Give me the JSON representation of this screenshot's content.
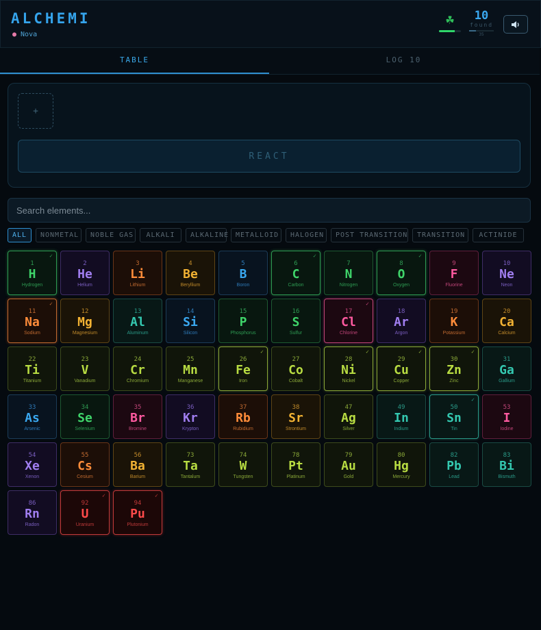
{
  "header": {
    "title": "ALCHEMI",
    "player_name": "Nova",
    "player_icon": "brain-icon",
    "luck_icon": "shamrock-icon",
    "luck_fraction": 0.72,
    "found_count": "10",
    "found_label": "found",
    "found_total": "35",
    "sound_icon": "speaker-icon"
  },
  "tabs": [
    {
      "label": "TABLE",
      "active": true
    },
    {
      "label": "LOG 10",
      "active": false
    }
  ],
  "reactor": {
    "slot_label": "+",
    "react_label": "REACT"
  },
  "search": {
    "placeholder": "Search elements..."
  },
  "filters": [
    "ALL",
    "NONMETAL",
    "NOBLE GAS",
    "ALKALI",
    "ALKALINE",
    "METALLOID",
    "HALOGEN",
    "POST TRANSITION",
    "TRANSITION",
    "ACTINIDE"
  ],
  "active_filter": "ALL",
  "categories": {
    "nonmetal": {
      "text": "#3fd46a",
      "border": "#1e5a32",
      "bg": "#08170f",
      "sub": "#2e9a52"
    },
    "noble": {
      "text": "#a07ef0",
      "border": "#3f2d66",
      "bg": "#120c22",
      "sub": "#7a5ec0"
    },
    "alkali": {
      "text": "#ff8c3a",
      "border": "#6a3518",
      "bg": "#1c0e07",
      "sub": "#c06a30"
    },
    "alkaline": {
      "text": "#f2b233",
      "border": "#5f4515",
      "bg": "#1a1307",
      "sub": "#c08a2a"
    },
    "metalloid": {
      "text": "#3aa8f0",
      "border": "#1c3c58",
      "bg": "#08131f",
      "sub": "#2e7ab8"
    },
    "halogen": {
      "text": "#ff5aa0",
      "border": "#5f1f3c",
      "bg": "#1c0811",
      "sub": "#c04578"
    },
    "transition": {
      "text": "#b8dc42",
      "border": "#3d4b1c",
      "bg": "#10150a",
      "sub": "#8aa838"
    },
    "post": {
      "text": "#34c8b0",
      "border": "#1a4b44",
      "bg": "#081816",
      "sub": "#2a9a88"
    },
    "actinide": {
      "text": "#ff4a4a",
      "border": "#6a1c1c",
      "bg": "#1c0707",
      "sub": "#c03a3a"
    }
  },
  "elements": [
    {
      "n": "1",
      "sym": "H",
      "name": "Hydrogen",
      "cat": "nonmetal",
      "found": true
    },
    {
      "n": "2",
      "sym": "He",
      "name": "Helium",
      "cat": "noble",
      "found": false
    },
    {
      "n": "3",
      "sym": "Li",
      "name": "Lithium",
      "cat": "alkali",
      "found": false
    },
    {
      "n": "4",
      "sym": "Be",
      "name": "Beryllium",
      "cat": "alkaline",
      "found": false
    },
    {
      "n": "5",
      "sym": "B",
      "name": "Boron",
      "cat": "metalloid",
      "found": false
    },
    {
      "n": "6",
      "sym": "C",
      "name": "Carbon",
      "cat": "nonmetal",
      "found": true
    },
    {
      "n": "7",
      "sym": "N",
      "name": "Nitrogen",
      "cat": "nonmetal",
      "found": false
    },
    {
      "n": "8",
      "sym": "O",
      "name": "Oxygen",
      "cat": "nonmetal",
      "found": true
    },
    {
      "n": "9",
      "sym": "F",
      "name": "Fluorine",
      "cat": "halogen",
      "found": false
    },
    {
      "n": "10",
      "sym": "Ne",
      "name": "Neon",
      "cat": "noble",
      "found": false
    },
    {
      "n": "11",
      "sym": "Na",
      "name": "Sodium",
      "cat": "alkali",
      "found": true
    },
    {
      "n": "12",
      "sym": "Mg",
      "name": "Magnesium",
      "cat": "alkaline",
      "found": false
    },
    {
      "n": "13",
      "sym": "Al",
      "name": "Aluminum",
      "cat": "post",
      "found": false
    },
    {
      "n": "14",
      "sym": "Si",
      "name": "Silicon",
      "cat": "metalloid",
      "found": false
    },
    {
      "n": "15",
      "sym": "P",
      "name": "Phosphorus",
      "cat": "nonmetal",
      "found": false
    },
    {
      "n": "16",
      "sym": "S",
      "name": "Sulfur",
      "cat": "nonmetal",
      "found": false
    },
    {
      "n": "17",
      "sym": "Cl",
      "name": "Chlorine",
      "cat": "halogen",
      "found": true
    },
    {
      "n": "18",
      "sym": "Ar",
      "name": "Argon",
      "cat": "noble",
      "found": false
    },
    {
      "n": "19",
      "sym": "K",
      "name": "Potassium",
      "cat": "alkali",
      "found": false
    },
    {
      "n": "20",
      "sym": "Ca",
      "name": "Calcium",
      "cat": "alkaline",
      "found": false
    },
    {
      "n": "22",
      "sym": "Ti",
      "name": "Titanium",
      "cat": "transition",
      "found": false
    },
    {
      "n": "23",
      "sym": "V",
      "name": "Vanadium",
      "cat": "transition",
      "found": false
    },
    {
      "n": "24",
      "sym": "Cr",
      "name": "Chromium",
      "cat": "transition",
      "found": false
    },
    {
      "n": "25",
      "sym": "Mn",
      "name": "Manganese",
      "cat": "transition",
      "found": false
    },
    {
      "n": "26",
      "sym": "Fe",
      "name": "Iron",
      "cat": "transition",
      "found": true
    },
    {
      "n": "27",
      "sym": "Co",
      "name": "Cobalt",
      "cat": "transition",
      "found": false
    },
    {
      "n": "28",
      "sym": "Ni",
      "name": "Nickel",
      "cat": "transition",
      "found": true
    },
    {
      "n": "29",
      "sym": "Cu",
      "name": "Copper",
      "cat": "transition",
      "found": true
    },
    {
      "n": "30",
      "sym": "Zn",
      "name": "Zinc",
      "cat": "transition",
      "found": true
    },
    {
      "n": "31",
      "sym": "Ga",
      "name": "Gallium",
      "cat": "post",
      "found": false
    },
    {
      "n": "33",
      "sym": "As",
      "name": "Arsenic",
      "cat": "metalloid",
      "found": false
    },
    {
      "n": "34",
      "sym": "Se",
      "name": "Selenium",
      "cat": "nonmetal",
      "found": false
    },
    {
      "n": "35",
      "sym": "Br",
      "name": "Bromine",
      "cat": "halogen",
      "found": false
    },
    {
      "n": "36",
      "sym": "Kr",
      "name": "Krypton",
      "cat": "noble",
      "found": false
    },
    {
      "n": "37",
      "sym": "Rb",
      "name": "Rubidium",
      "cat": "alkali",
      "found": false
    },
    {
      "n": "38",
      "sym": "Sr",
      "name": "Strontium",
      "cat": "alkaline",
      "found": false
    },
    {
      "n": "47",
      "sym": "Ag",
      "name": "Silver",
      "cat": "transition",
      "found": false
    },
    {
      "n": "49",
      "sym": "In",
      "name": "Indium",
      "cat": "post",
      "found": false
    },
    {
      "n": "50",
      "sym": "Sn",
      "name": "Tin",
      "cat": "post",
      "found": true
    },
    {
      "n": "53",
      "sym": "I",
      "name": "Iodine",
      "cat": "halogen",
      "found": false
    },
    {
      "n": "54",
      "sym": "Xe",
      "name": "Xenon",
      "cat": "noble",
      "found": false
    },
    {
      "n": "55",
      "sym": "Cs",
      "name": "Cesium",
      "cat": "alkali",
      "found": false
    },
    {
      "n": "56",
      "sym": "Ba",
      "name": "Barium",
      "cat": "alkaline",
      "found": false
    },
    {
      "n": "73",
      "sym": "Ta",
      "name": "Tantalum",
      "cat": "transition",
      "found": false
    },
    {
      "n": "74",
      "sym": "W",
      "name": "Tungsten",
      "cat": "transition",
      "found": false
    },
    {
      "n": "78",
      "sym": "Pt",
      "name": "Platinum",
      "cat": "transition",
      "found": false
    },
    {
      "n": "79",
      "sym": "Au",
      "name": "Gold",
      "cat": "transition",
      "found": false
    },
    {
      "n": "80",
      "sym": "Hg",
      "name": "Mercury",
      "cat": "transition",
      "found": false
    },
    {
      "n": "82",
      "sym": "Pb",
      "name": "Lead",
      "cat": "post",
      "found": false
    },
    {
      "n": "83",
      "sym": "Bi",
      "name": "Bismuth",
      "cat": "post",
      "found": false
    },
    {
      "n": "86",
      "sym": "Rn",
      "name": "Radon",
      "cat": "noble",
      "found": false
    },
    {
      "n": "92",
      "sym": "U",
      "name": "Uranium",
      "cat": "actinide",
      "found": true
    },
    {
      "n": "94",
      "sym": "Pu",
      "name": "Plutonium",
      "cat": "actinide",
      "found": true
    }
  ],
  "found_mark": "✓"
}
